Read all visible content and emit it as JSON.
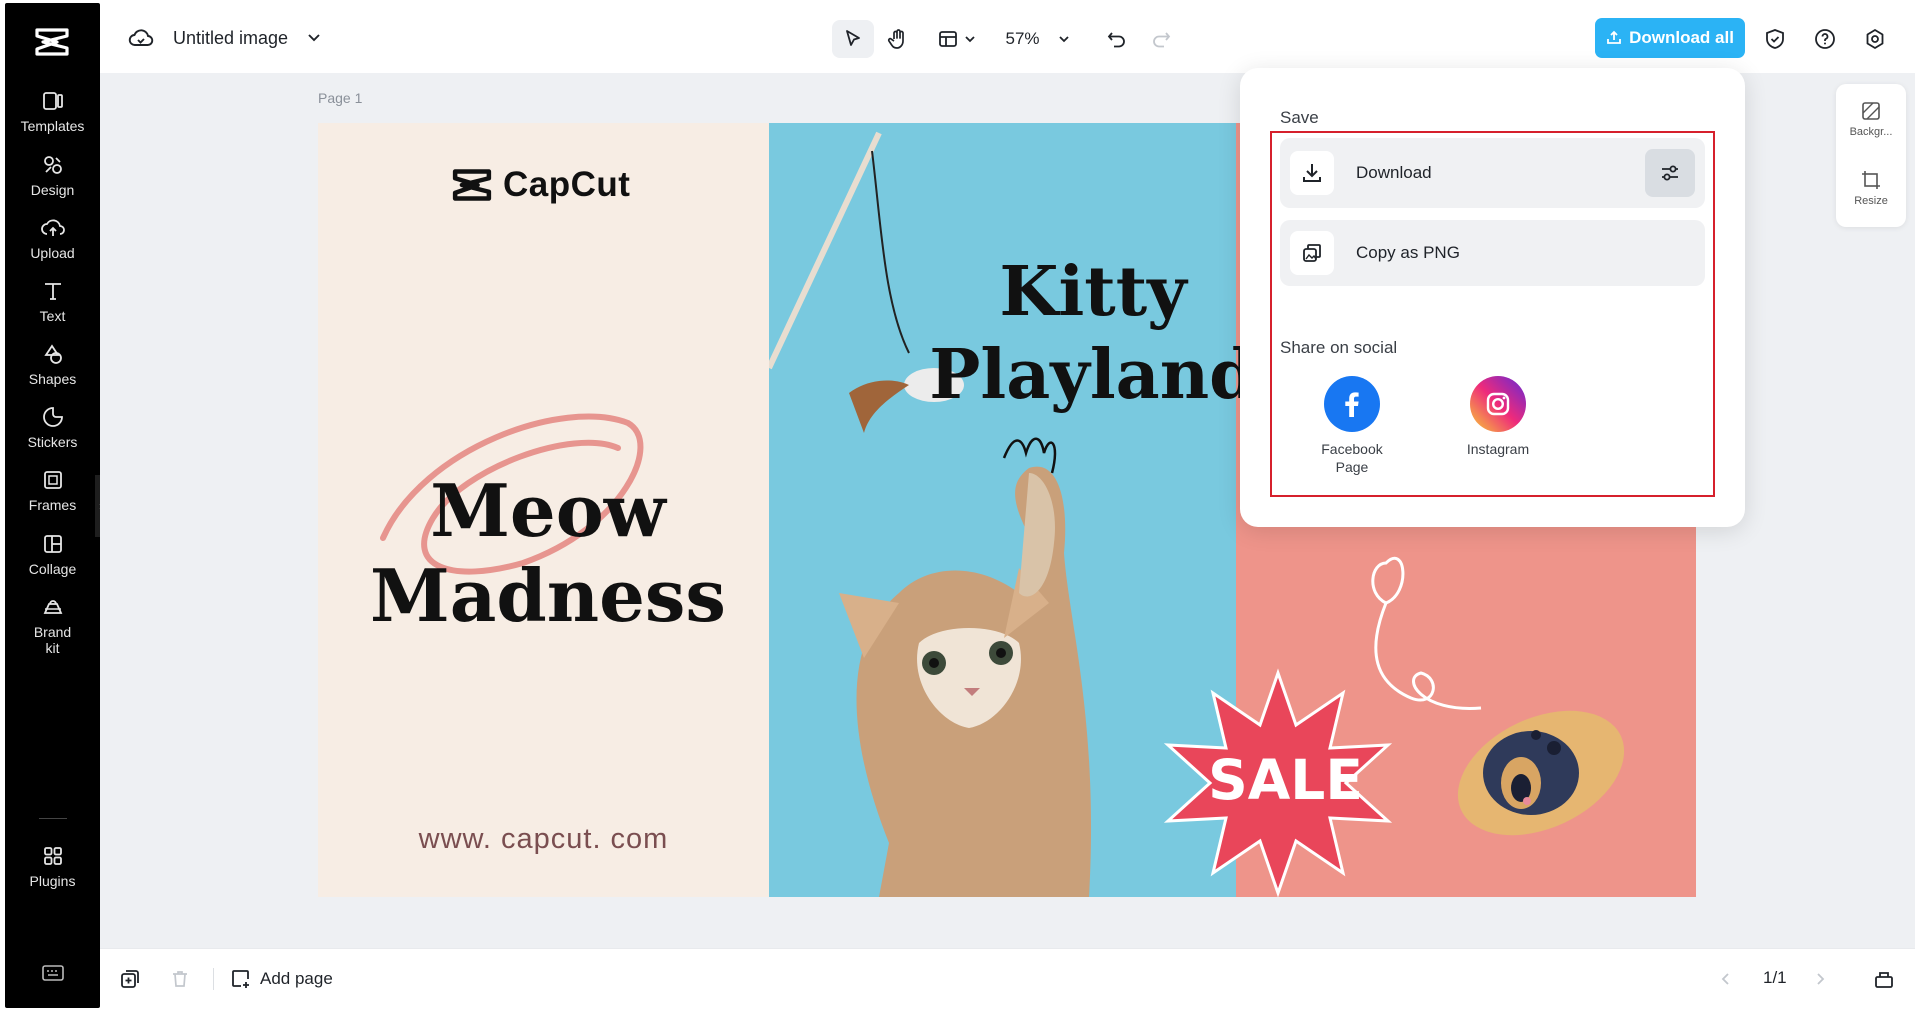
{
  "app": {
    "document_title": "Untitled image"
  },
  "rail": {
    "items": [
      {
        "label": "Templates",
        "icon": "templates-icon"
      },
      {
        "label": "Design",
        "icon": "design-icon"
      },
      {
        "label": "Upload",
        "icon": "upload-icon"
      },
      {
        "label": "Text",
        "icon": "text-icon"
      },
      {
        "label": "Shapes",
        "icon": "shapes-icon"
      },
      {
        "label": "Stickers",
        "icon": "stickers-icon"
      },
      {
        "label": "Frames",
        "icon": "frames-icon"
      },
      {
        "label": "Collage",
        "icon": "collage-icon"
      },
      {
        "label": "Brand\nkit",
        "icon": "brand-kit-icon"
      },
      {
        "label": "Plugins",
        "icon": "plugins-icon"
      }
    ]
  },
  "toolbar": {
    "zoom": "57%",
    "download_all": "Download all"
  },
  "workspace": {
    "page_label": "Page 1"
  },
  "canvas": {
    "brand": "CapCut",
    "headline_left": "Meow\nMadness",
    "website": "www. capcut. com",
    "headline_right": "Kitty\nPlayland",
    "badge": "SALE",
    "colors": {
      "cream": "#f7ede4",
      "blue": "#79c9df",
      "pink": "#ee948a",
      "sale": "#e9465a"
    }
  },
  "mini_bar": {
    "background": "Backgr...",
    "resize": "Resize"
  },
  "popover": {
    "save_title": "Save",
    "download": "Download",
    "copy_png": "Copy as PNG",
    "share_title": "Share on social",
    "facebook": "Facebook\nPage",
    "instagram": "Instagram"
  },
  "bottom": {
    "add_page": "Add page",
    "page_count": "1/1"
  },
  "colors": {
    "accent": "#2bb3f5",
    "highlight": "#d6202c"
  }
}
